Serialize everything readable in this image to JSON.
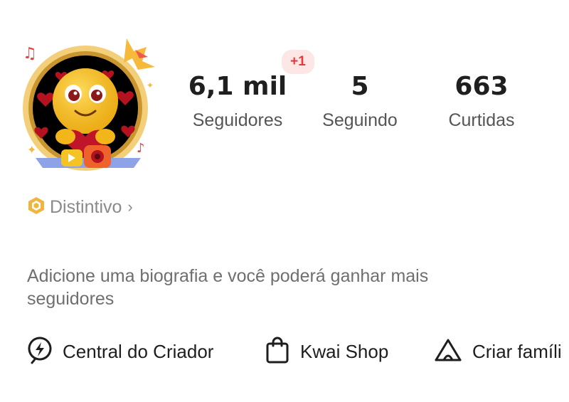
{
  "profile": {
    "stats": {
      "followers": {
        "value": "6,1 mil",
        "label": "Seguidores",
        "delta": "+1"
      },
      "following": {
        "value": "5",
        "label": "Seguindo"
      },
      "likes": {
        "value": "663",
        "label": "Curtidas"
      }
    },
    "distintivo": {
      "label": "Distintivo",
      "chevron": "›"
    },
    "bio_prompt": "Adicione uma biografia e você poderá ganhar mais seguidores"
  },
  "actions": [
    {
      "label": "Central do Criador",
      "icon": "lightning-bolt-icon"
    },
    {
      "label": "Kwai Shop",
      "icon": "shopping-bag-icon"
    },
    {
      "label": "Criar famíli",
      "icon": "tent-icon"
    }
  ],
  "colors": {
    "badge_bg": "#fde6e6",
    "badge_text": "#e23b3b",
    "gold": "#d9a93b",
    "muted_text": "#8a8a8a"
  }
}
